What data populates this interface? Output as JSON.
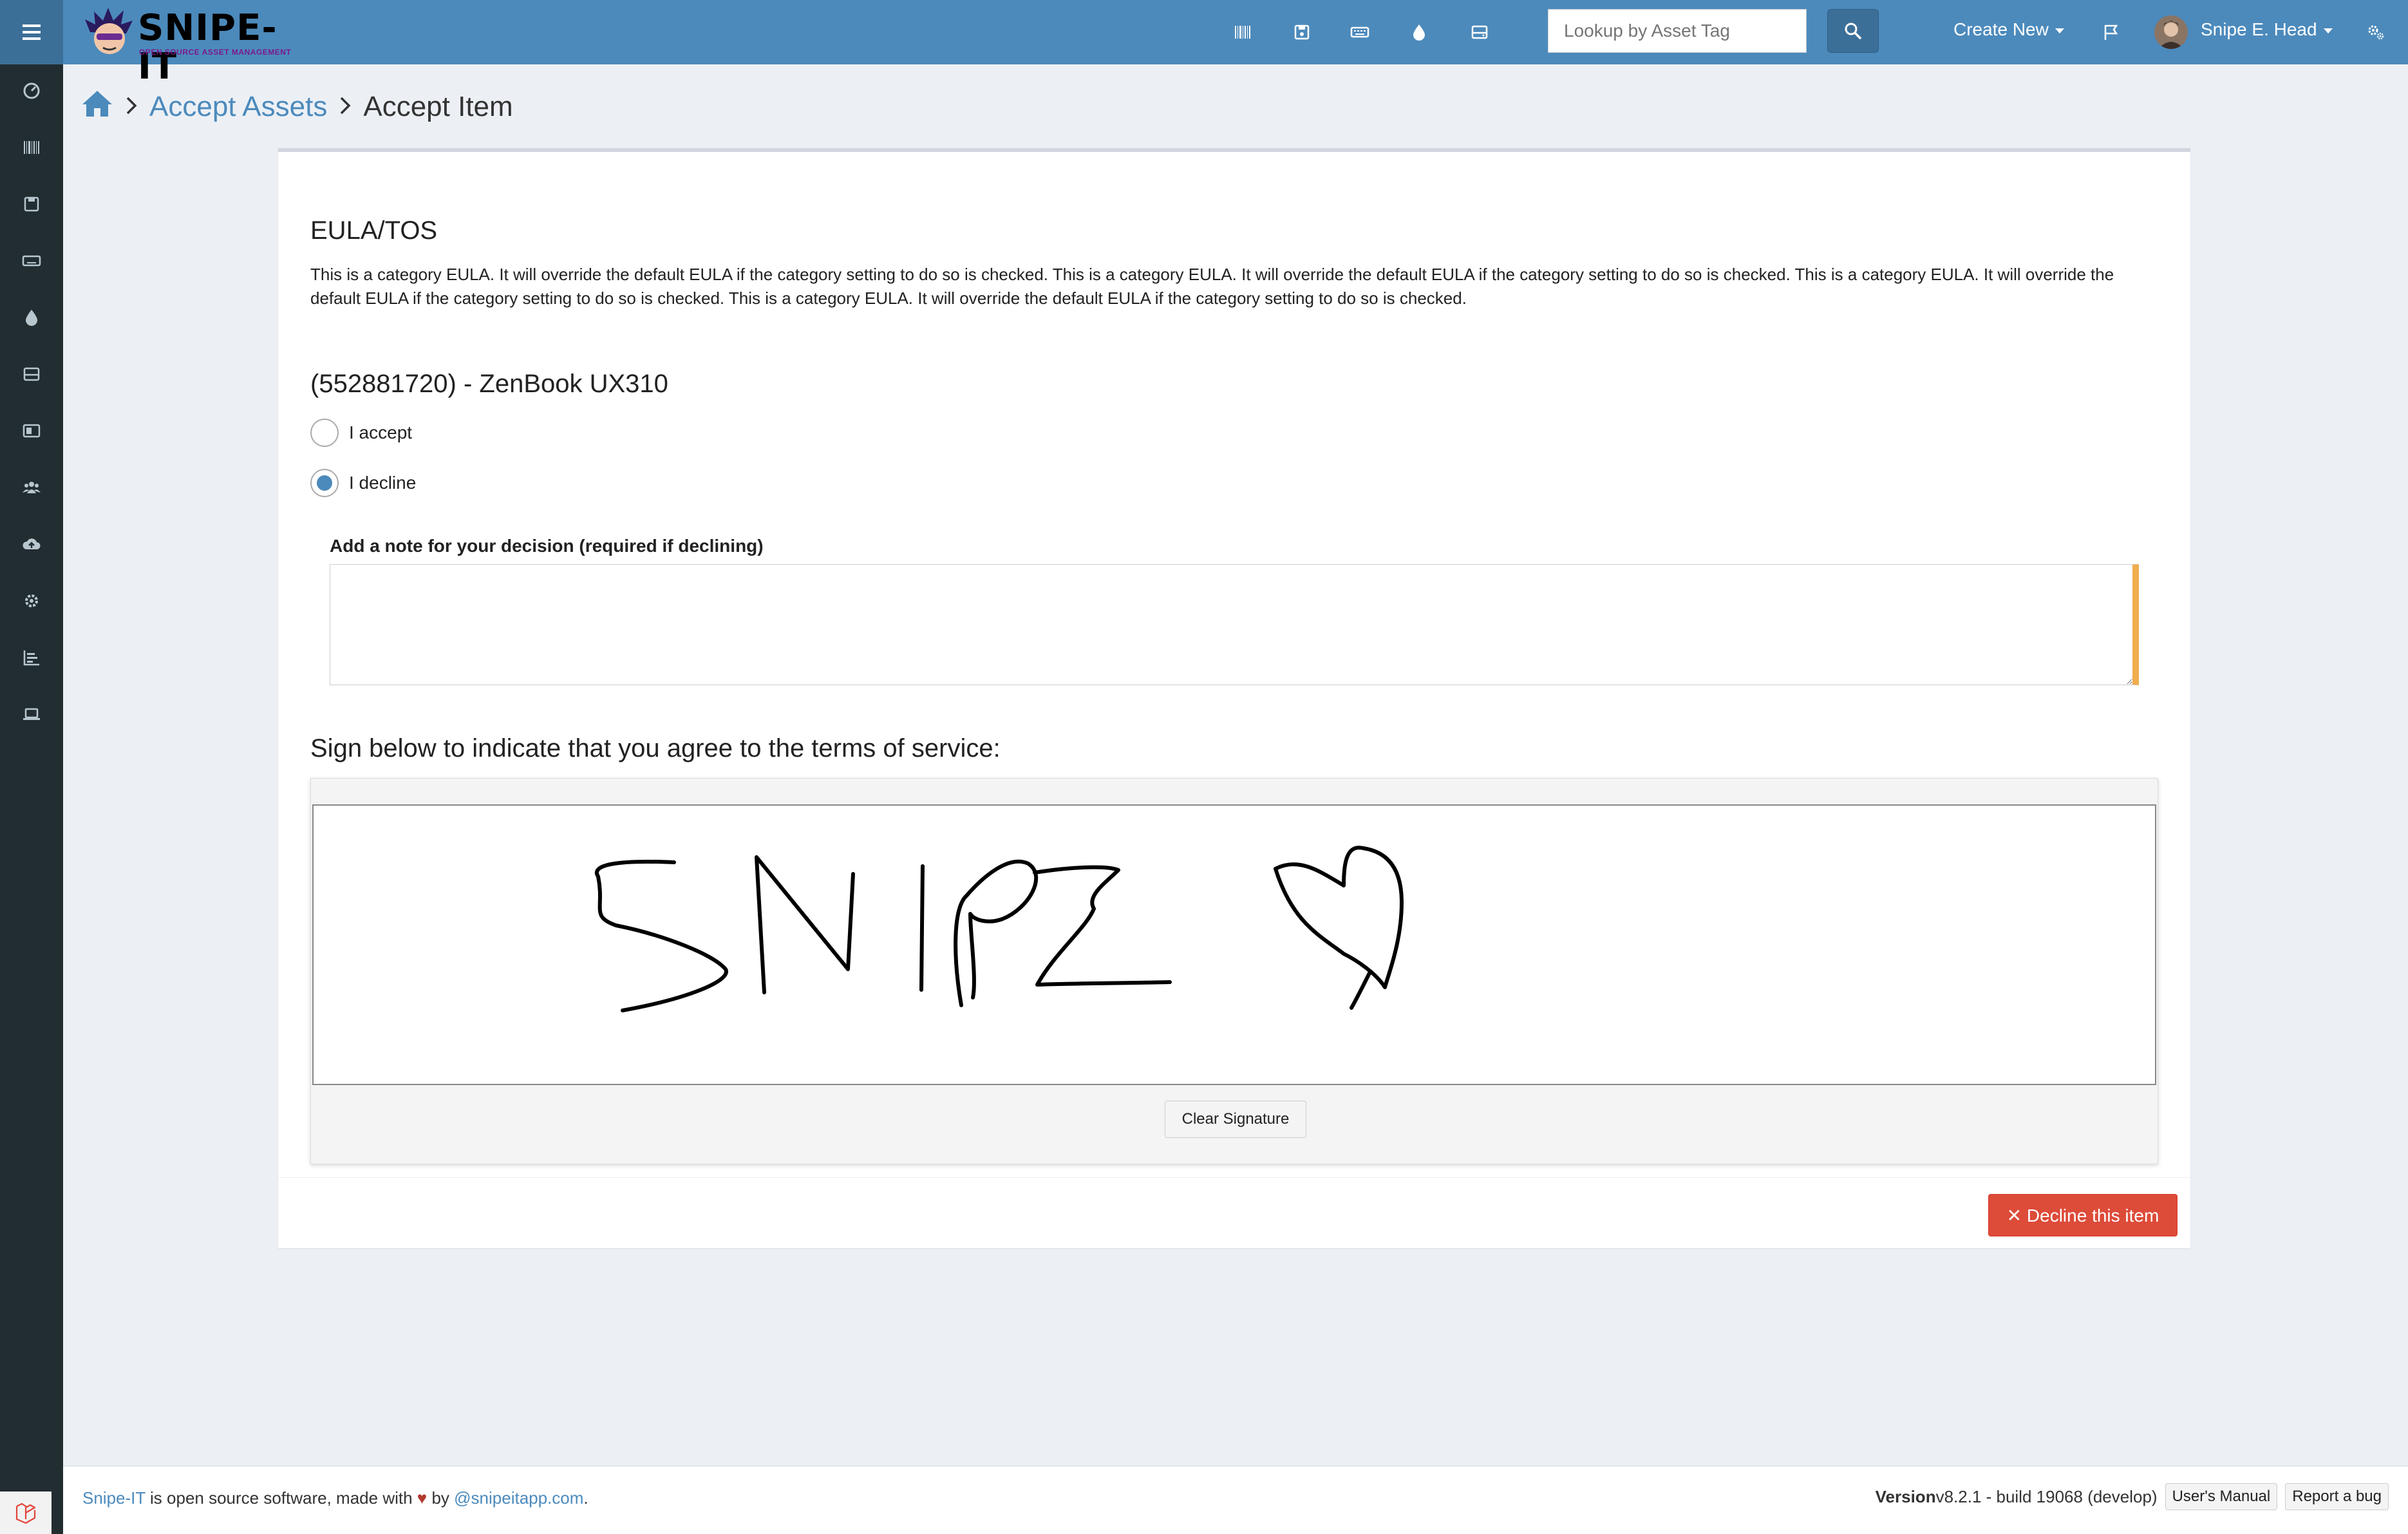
{
  "app": {
    "name": "SNIPE-IT",
    "tagline": "OPEN SOURCE ASSET MANAGEMENT"
  },
  "navbar": {
    "search_placeholder": "Lookup by Asset Tag",
    "create_new_label": "Create New",
    "user_name": "Snipe E. Head",
    "icons": [
      "barcode-icon",
      "save-icon",
      "keyboard-icon",
      "tint-icon",
      "hdd-icon"
    ]
  },
  "sidebar": {
    "icons": [
      "dashboard-icon",
      "barcode-icon",
      "save-icon",
      "keyboard-icon",
      "tint-icon",
      "hdd-icon",
      "license-icon",
      "users-icon",
      "cloud-upload-icon",
      "gear-icon",
      "reports-icon",
      "laptop-icon"
    ]
  },
  "breadcrumb": {
    "parent": "Accept Assets",
    "current": "Accept Item"
  },
  "eula": {
    "title": "EULA/TOS",
    "text": "This is a category EULA. It will override the default EULA if the category setting to do so is checked. This is a category EULA. It will override the default EULA if the category setting to do so is checked. This is a category EULA. It will override the default EULA if the category setting to do so is checked. This is a category EULA. It will override the default EULA if the category setting to do so is checked."
  },
  "item": {
    "title": "(552881720) - ZenBook UX310",
    "accept_label": "I accept",
    "decline_label": "I decline",
    "selected": "decline"
  },
  "note": {
    "label": "Add a note for your decision (required if declining)",
    "value": ""
  },
  "signature": {
    "prompt": "Sign below to indicate that you agree to the terms of service:",
    "clear_label": "Clear Signature"
  },
  "actions": {
    "decline_label": "✕ Decline this item"
  },
  "footer": {
    "brand_link": "Snipe-IT",
    "text_mid": " is open source software, made with ",
    "heart": "♥",
    "text_by": " by ",
    "handle_link": "@snipeitapp.com",
    "text_end": ".",
    "version_label": "Version",
    "version_value": " v8.2.1 - build 19068 (develop)",
    "manual_label": "User's Manual",
    "bug_label": "Report a bug"
  },
  "colors": {
    "navbar": "#4c8abc",
    "sidebar": "#222d32",
    "danger": "#dd4b39",
    "warning": "#f0ad4e",
    "link": "#4c8abc"
  }
}
